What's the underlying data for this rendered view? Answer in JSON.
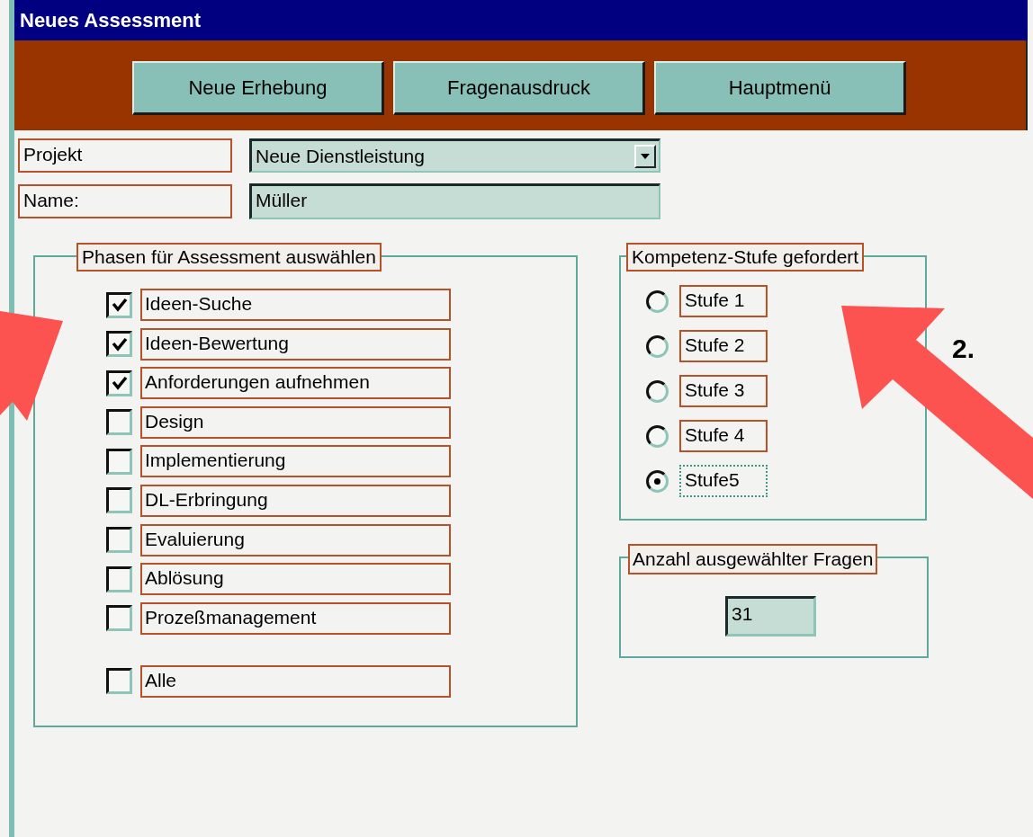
{
  "window": {
    "title": "Neues Assessment"
  },
  "toolbar": {
    "buttons": [
      "Neue Erhebung",
      "Fragenausdruck",
      "Hauptmenü"
    ]
  },
  "fields": [
    {
      "label": "Projekt",
      "value": "Neue Dienstleistung",
      "kind": "dropdown"
    },
    {
      "label": "Name:",
      "value": "Müller",
      "kind": "text"
    }
  ],
  "phases": {
    "title": "Phasen für Assessment auswählen",
    "items": [
      {
        "label": "Ideen-Suche",
        "checked": true
      },
      {
        "label": "Ideen-Bewertung",
        "checked": true
      },
      {
        "label": "Anforderungen aufnehmen",
        "checked": true
      },
      {
        "label": "Design",
        "checked": false
      },
      {
        "label": "Implementierung",
        "checked": false
      },
      {
        "label": "DL-Erbringung",
        "checked": false
      },
      {
        "label": "Evaluierung",
        "checked": false
      },
      {
        "label": "Ablösung",
        "checked": false
      },
      {
        "label": "Prozeßmanagement",
        "checked": false
      }
    ],
    "all_option": {
      "label": "Alle",
      "checked": false
    }
  },
  "levels": {
    "title": "Kompetenz-Stufe gefordert",
    "items": [
      {
        "label": "Stufe 1",
        "selected": false
      },
      {
        "label": "Stufe 2",
        "selected": false
      },
      {
        "label": "Stufe 3",
        "selected": false
      },
      {
        "label": "Stufe 4",
        "selected": false
      },
      {
        "label": "Stufe5",
        "selected": true
      }
    ]
  },
  "question_count": {
    "title": "Anzahl ausgewählter Fragen",
    "value": "31"
  },
  "annotation_label": "2."
}
